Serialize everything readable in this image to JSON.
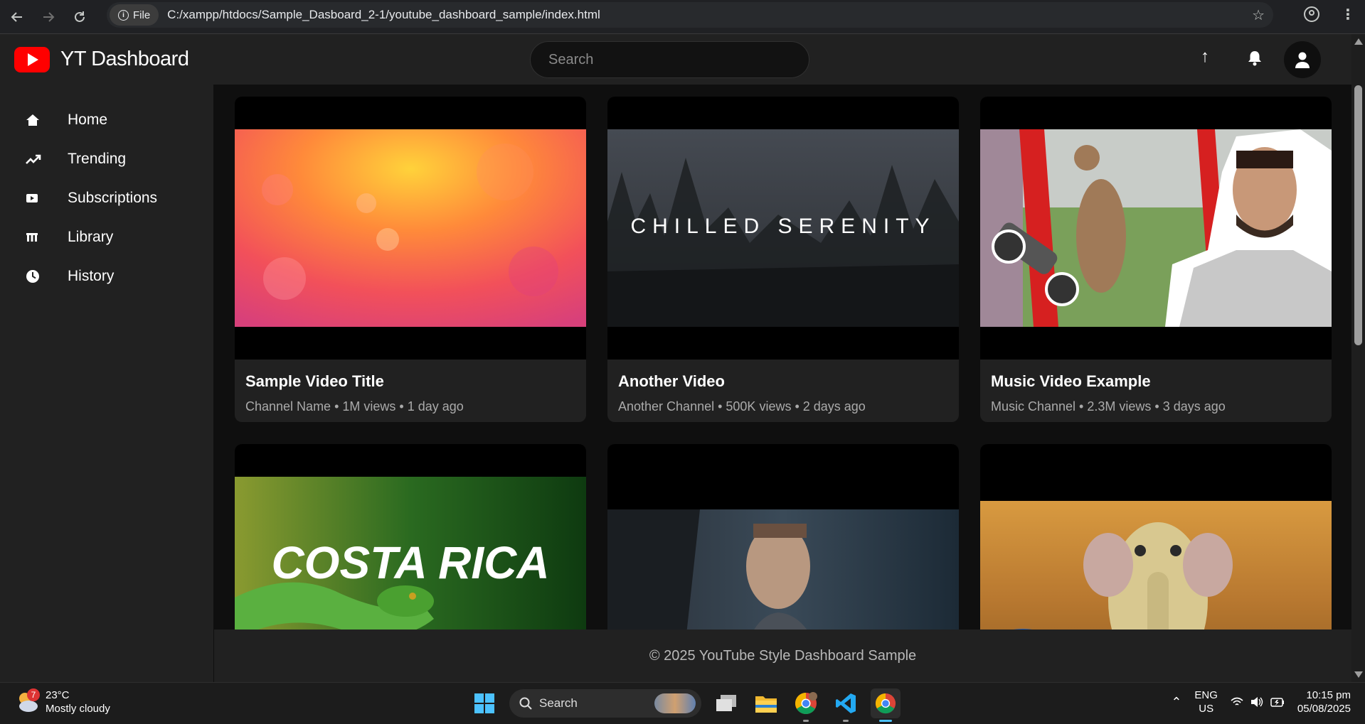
{
  "browser": {
    "file_label": "File",
    "url": "C:/xampp/htdocs/Sample_Dasboard_2-1/youtube_dashboard_sample/index.html"
  },
  "header": {
    "title": "YT Dashboard",
    "search_placeholder": "Search"
  },
  "sidebar": {
    "items": [
      {
        "label": "Home",
        "icon": "home-icon"
      },
      {
        "label": "Trending",
        "icon": "trending-icon"
      },
      {
        "label": "Subscriptions",
        "icon": "subscriptions-icon"
      },
      {
        "label": "Library",
        "icon": "library-icon"
      },
      {
        "label": "History",
        "icon": "history-icon"
      }
    ]
  },
  "videos": [
    {
      "title": "Sample Video Title",
      "meta": "Channel Name • 1M views • 1 day ago"
    },
    {
      "title": "Another Video",
      "meta": "Another Channel • 500K views • 2 days ago",
      "thumb_text": "CHILLED SERENITY"
    },
    {
      "title": "Music Video Example",
      "meta": "Music Channel • 2.3M views • 3 days ago"
    },
    {
      "title": "",
      "meta": "",
      "thumb_text": "COSTA RICA"
    },
    {
      "title": "",
      "meta": ""
    },
    {
      "title": "",
      "meta": ""
    }
  ],
  "footer": {
    "text": "© 2025 YouTube Style Dashboard Sample"
  },
  "taskbar": {
    "weather_temp": "23°C",
    "weather_desc": "Mostly cloudy",
    "weather_badge": "7",
    "search_label": "Search",
    "lang_top": "ENG",
    "lang_bottom": "US",
    "time": "10:15 pm",
    "date": "05/08/2025"
  },
  "colors": {
    "accent": "#ff0000",
    "background": "#0f0f0f",
    "surface": "#212121"
  }
}
